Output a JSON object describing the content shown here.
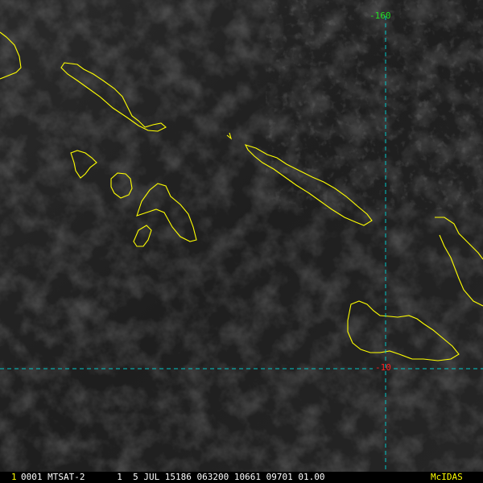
{
  "image": {
    "grid_lines": {
      "longitude_label": "-160",
      "latitude_label": "-10"
    },
    "colors": {
      "coastline": "#ffff00",
      "grid_line": "#00c8c8",
      "longitude_label": "#22dd22",
      "latitude_label": "#ff2020",
      "status_text": "#ffffff",
      "frame_number": "#ffff00",
      "brand": "#ffff00",
      "background": "#1a1a1a"
    }
  },
  "status_bar": {
    "frame_number": "1",
    "info": "0001 MTSAT-2      1  5 JUL 15186 063200 10661 09701 01.00",
    "brand": "McIDAS"
  }
}
